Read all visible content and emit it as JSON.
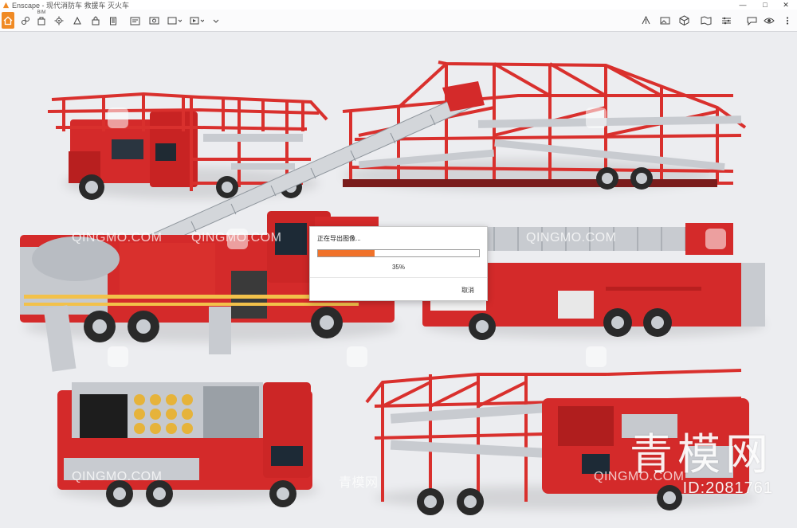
{
  "window": {
    "title": "Enscape - 现代消防车 救援车 灭火车",
    "controls": [
      "—",
      "□",
      "✕"
    ]
  },
  "toolbar": {
    "left_items": [
      {
        "icon": "home-icon"
      },
      {
        "icon": "link-icon"
      },
      {
        "icon": "bim-icon",
        "label": "BIM"
      },
      {
        "icon": "settings-gear-icon"
      },
      {
        "icon": "sun-icon"
      },
      {
        "icon": "asset-library-icon"
      },
      {
        "icon": "building-icon"
      },
      {
        "icon": "clipboard-icon"
      },
      {
        "icon": "screenshot-icon"
      },
      {
        "icon": "batch-render-icon"
      },
      {
        "icon": "video-export-icon"
      },
      {
        "icon": "export-icon"
      }
    ],
    "right_items": [
      {
        "icon": "upload-icon"
      },
      {
        "icon": "image-icon"
      },
      {
        "icon": "cube-icon"
      },
      {
        "icon": "map-icon"
      },
      {
        "icon": "settings-sliders-icon"
      },
      {
        "icon": "feedback-icon"
      },
      {
        "icon": "eye-icon"
      },
      {
        "icon": "more-icon"
      }
    ]
  },
  "dialog": {
    "title": "正在导出图像...",
    "progress": 0.35,
    "progress_text": "35%",
    "cancel_label": "取消"
  },
  "watermarks": {
    "text": "QINGMO.COM",
    "cn_text": "青模网",
    "big_cn": "青模网",
    "id_text": "ID:2081761"
  },
  "colors": {
    "accent": "#f08a24",
    "progress": "#f0722a",
    "truck_red": "#d42a2a"
  }
}
